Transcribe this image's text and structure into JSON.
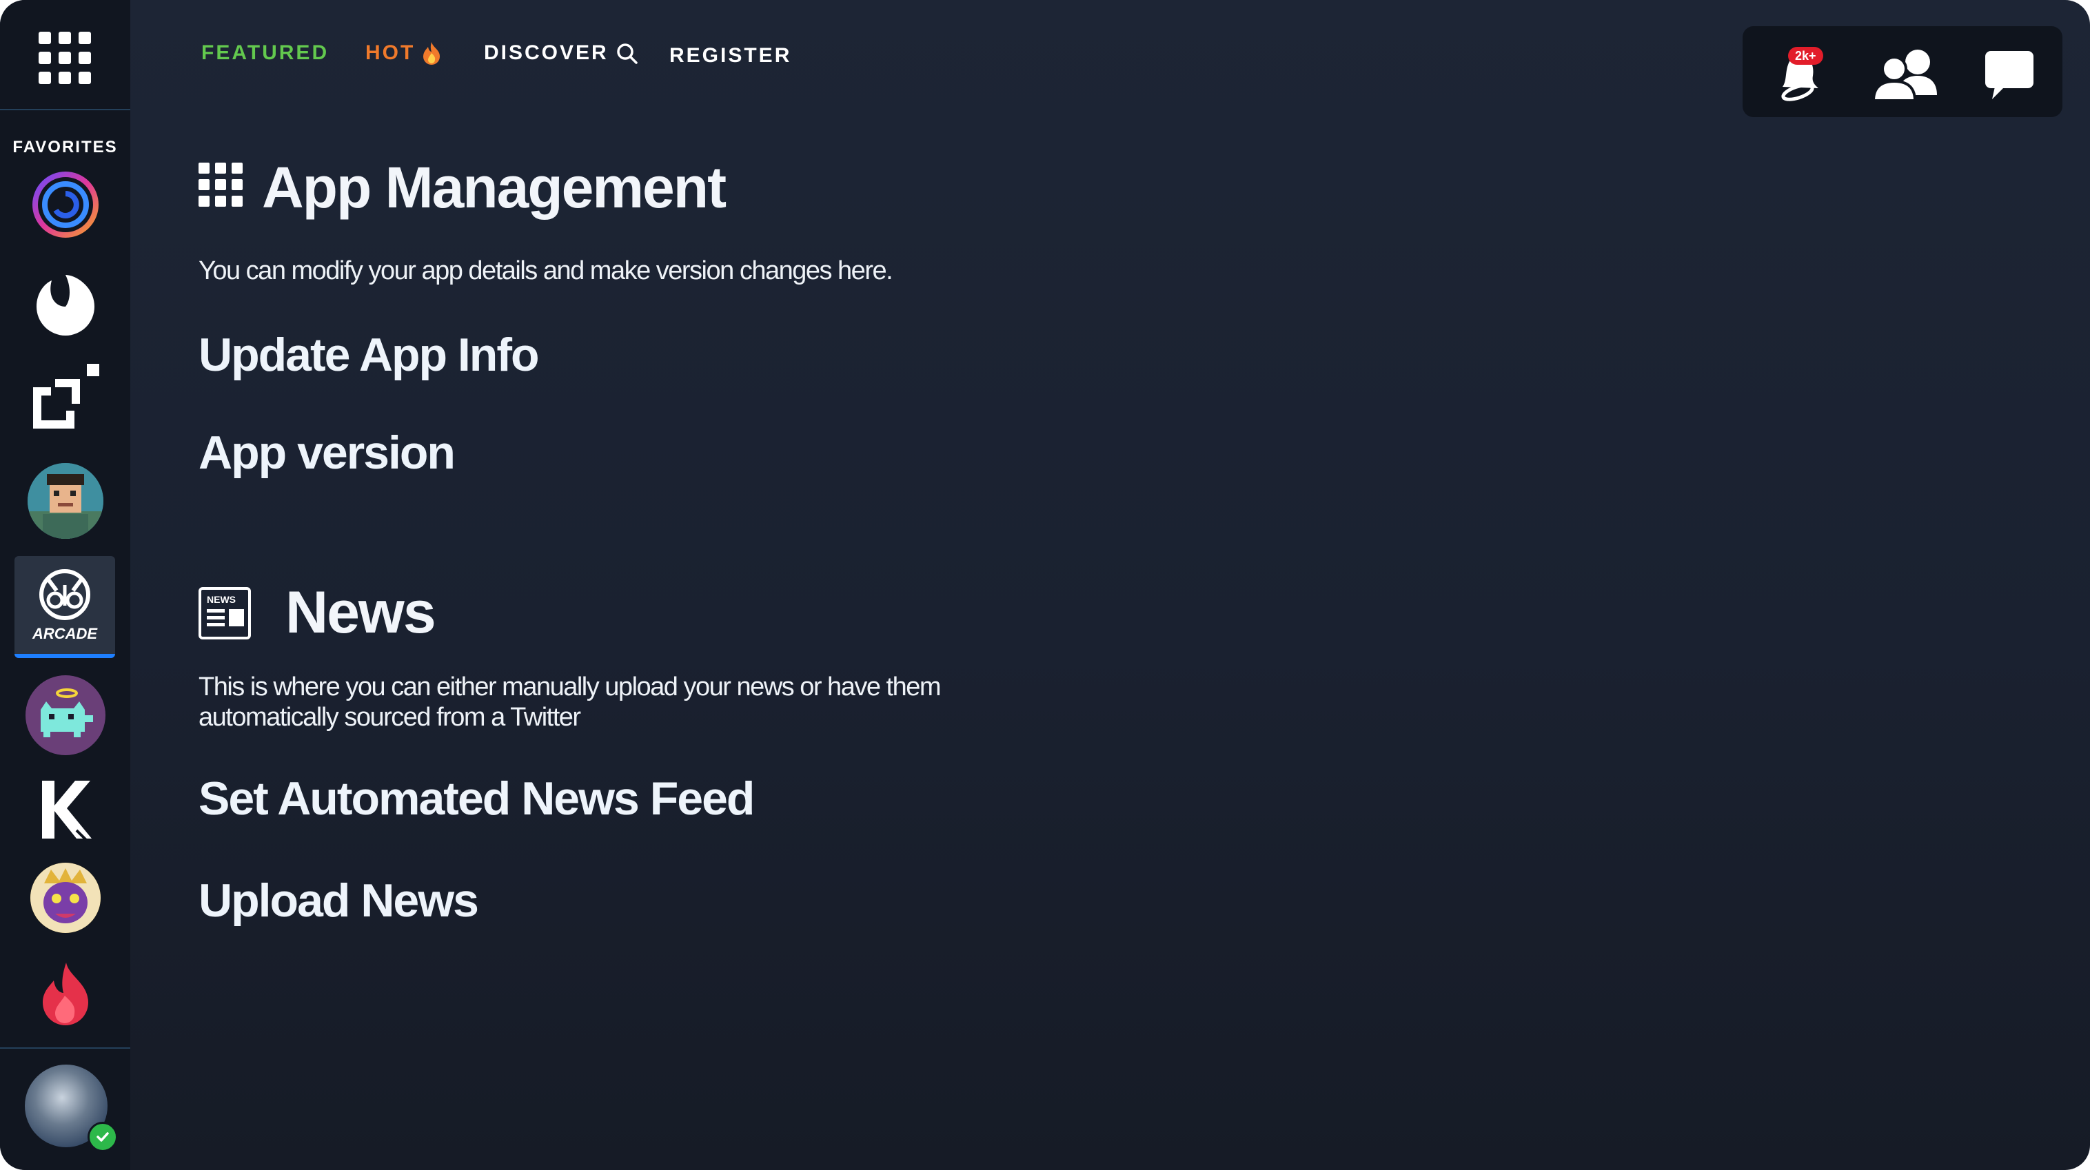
{
  "sidebar": {
    "favorites_label": "FAVORITES",
    "favorites": [
      {
        "name": "spiral-app-icon"
      },
      {
        "name": "white-drop-app-icon"
      },
      {
        "name": "bracket-app-icon"
      },
      {
        "name": "pixel-character-avatar"
      },
      {
        "name": "arcade-app-icon",
        "label": "ARCADE",
        "selected": true
      },
      {
        "name": "pixel-cat-avatar"
      },
      {
        "name": "k-logo-app-icon"
      },
      {
        "name": "tiger-mask-avatar"
      },
      {
        "name": "flame-app-icon"
      }
    ],
    "user": {
      "status": "online"
    }
  },
  "nav": {
    "featured": "FEATURED",
    "hot": "HOT",
    "discover": "DISCOVER",
    "register": "REGISTER",
    "colors": {
      "featured": "#63c94e",
      "hot": "#f07a2b",
      "default": "#ffffff"
    }
  },
  "top_actions": {
    "notifications_badge": "2k+"
  },
  "app_management": {
    "title": "App Management",
    "description": "You can modify your app details and make version changes here.",
    "links": [
      "Update App Info",
      "App version"
    ]
  },
  "news": {
    "icon_label": "NEWS",
    "title": "News",
    "description_line1": "This is where you can either manually upload your news or have them",
    "description_line2": "automatically sourced from a Twitter",
    "links": [
      "Set Automated News Feed",
      "Upload News"
    ]
  }
}
